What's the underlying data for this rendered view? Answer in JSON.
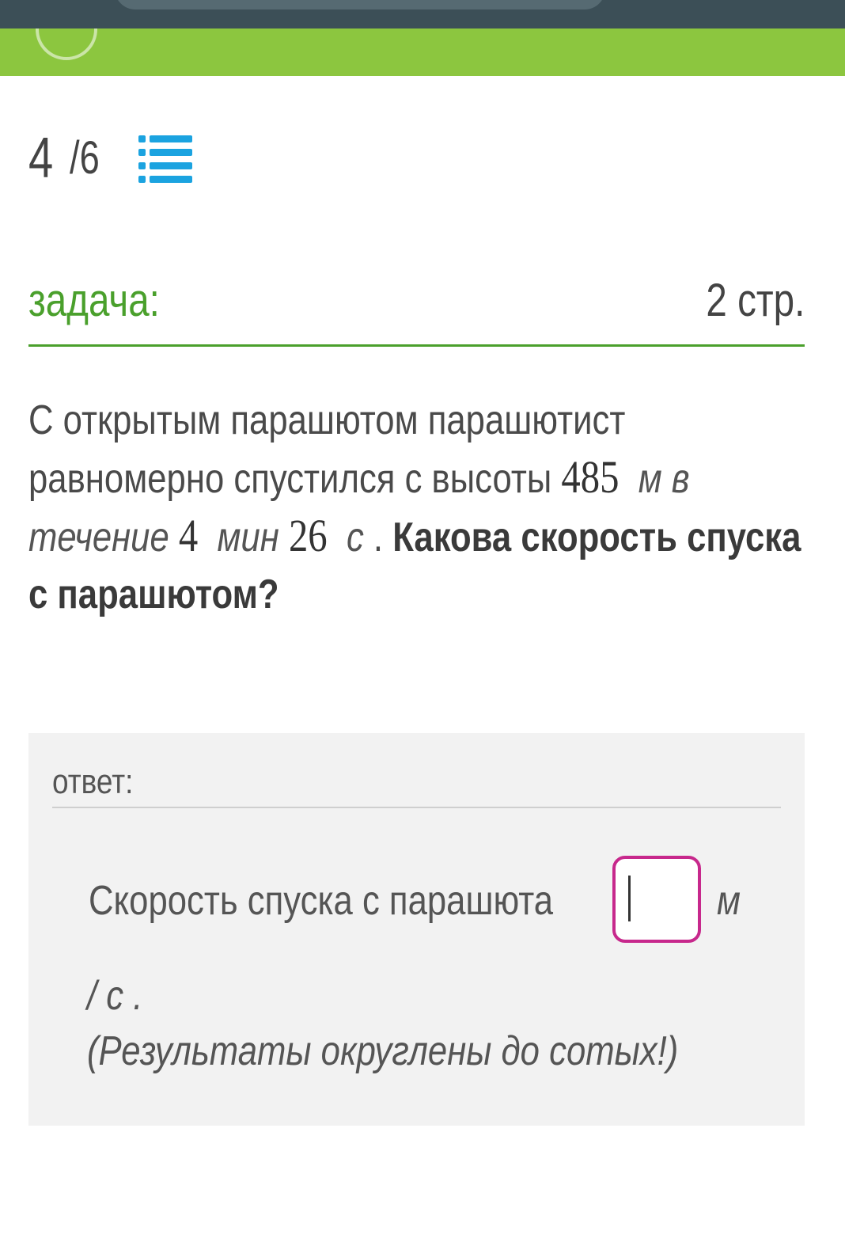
{
  "header": {
    "icons": [
      "avatar-icon",
      "search-bar"
    ]
  },
  "counter": {
    "current": "4",
    "total": "/6",
    "list_icon": "list-icon"
  },
  "section": {
    "label": "задача:",
    "pages": "2 стр."
  },
  "task": {
    "text_part1": "С открытым парашютом парашютист равномерно спустился с высоты ",
    "height_value": "485",
    "height_unit": "м",
    "text_part2": " в течение ",
    "minutes_value": "4",
    "minutes_unit": "мин",
    "seconds_value": "26",
    "seconds_unit": "с",
    "text_part3": " . ",
    "question": "Какова скорость спуска с парашютом?"
  },
  "answer": {
    "label": "ответ:",
    "prompt": "Скорость спуска с парашюта",
    "input_value": "",
    "unit_part1": "м",
    "unit_part2": "/ с .",
    "note": "(Результаты округлены до сотых!)"
  },
  "colors": {
    "topbar": "#3c4f57",
    "greenbar": "#8cc63f",
    "accent_green": "#4aa02c",
    "list_icon_blue": "#1ba3e0",
    "input_border": "#c7288c",
    "answer_bg": "#f2f2f2"
  }
}
